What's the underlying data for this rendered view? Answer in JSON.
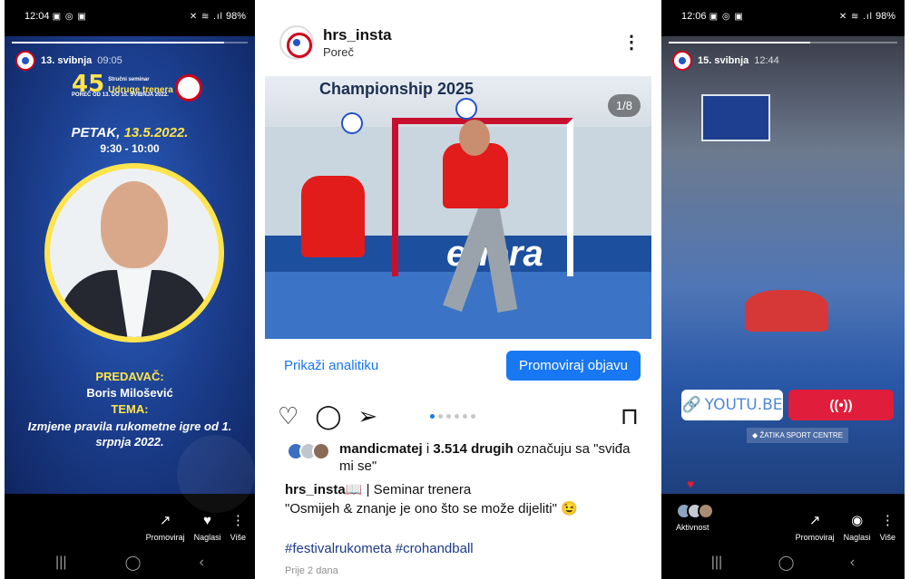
{
  "left": {
    "status": {
      "time": "12:04",
      "battery": "98%",
      "left_icons": "▣ ◎ ▣",
      "right_icons": "✕ ≋ .ıl"
    },
    "story": {
      "date": "13. svibnja",
      "time": "09:05",
      "progress_fraction": 0.9,
      "event_number": "45",
      "event_title": "Udruge trenera",
      "event_sub": "Stručni seminar",
      "event_place": "POREČ OD 13. DO 15. SVIBNJA 2022.",
      "day_prefix": "PETAK,",
      "day_date": "13.5.2022.",
      "time_range": "9:30 - 10:00",
      "speaker_label": "PREDAVAČ:",
      "speaker_name": "Boris Milošević",
      "topic_label": "TEMA:",
      "topic_text": "Izmjene pravila rukometne igre od 1. srpnja 2022."
    },
    "actions": [
      {
        "label": "Promoviraj",
        "icon": "trend-icon",
        "glyph": "↗"
      },
      {
        "label": "Naglasi",
        "icon": "heart-circle-icon",
        "glyph": "♥"
      },
      {
        "label": "Više",
        "icon": "more-vertical-icon",
        "glyph": "⋮"
      }
    ],
    "nav": {
      "recent": "|||",
      "home": "◯",
      "back": "‹"
    }
  },
  "mid": {
    "username": "hrs_insta",
    "location": "Poreč",
    "more_glyph": "⋮",
    "banner_text": "Championship 2025",
    "ad_text": "enera",
    "image_counter": "1/8",
    "analytics_link": "Prikaži analitiku",
    "promote_button": "Promoviraj objavu",
    "icons": {
      "like": "♡",
      "comment": "◯",
      "share": "➢",
      "save": "⊓"
    },
    "carousel": {
      "count": 6,
      "active": 0
    },
    "likes": {
      "user": "mandicmatej",
      "connector": "i",
      "count": "3.514 drugih",
      "suffix": "označuju sa \"sviđa mi se\""
    },
    "caption": {
      "user": "hrs_insta",
      "emoji": "📖",
      "line1": "| Seminar trenera",
      "line2": "\"Osmijeh & znanje je ono što se može dijeliti\" 😉"
    },
    "hashtags": "#festivalrukometa #crohandball",
    "time_ago": "Prije 2 dana"
  },
  "right": {
    "status": {
      "time": "12:06",
      "battery": "98%",
      "left_icons": "▣ ◎ ▣",
      "right_icons": "✕ ≋ .ıl"
    },
    "story": {
      "date": "15. svibnja",
      "time": "12:44",
      "progress_fraction": 0.62,
      "link_text": "YOUTU.BE",
      "live_glyph": "((•))",
      "location_text": "◆ ŽATIKA SPORT CENTRE"
    },
    "activity_label": "Aktivnost",
    "actions": [
      {
        "label": "Promoviraj",
        "icon": "trend-icon",
        "glyph": "↗"
      },
      {
        "label": "Naglasi",
        "icon": "highlight-icon",
        "glyph": "◉"
      },
      {
        "label": "Više",
        "icon": "more-vertical-icon",
        "glyph": "⋮"
      }
    ],
    "nav": {
      "recent": "|||",
      "home": "◯",
      "back": "‹"
    }
  },
  "colors": {
    "brand_blue": "#1877f2",
    "story_yellow": "#ffe44d",
    "live_red": "#e01d3a"
  }
}
